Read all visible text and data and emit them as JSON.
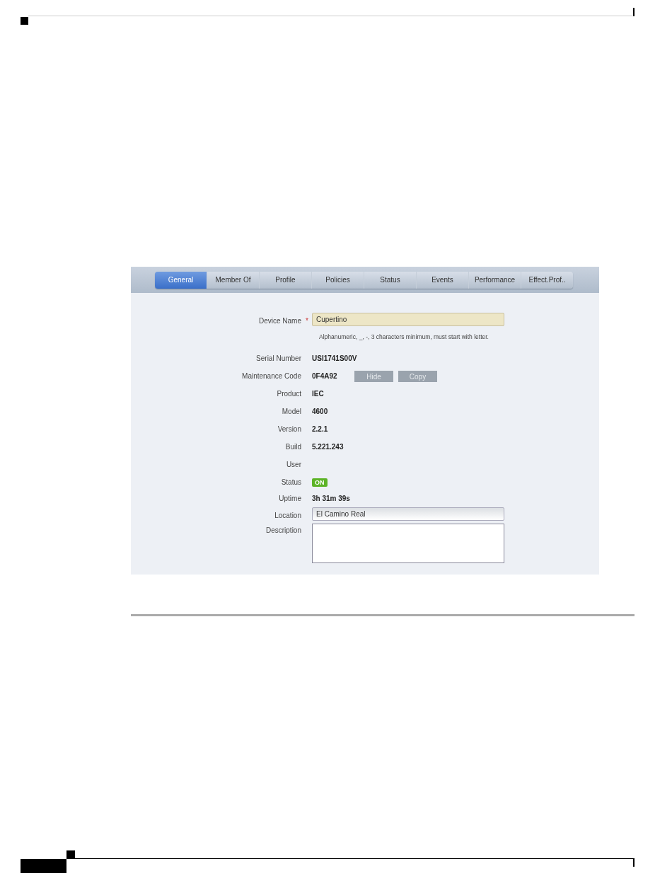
{
  "tabs": [
    {
      "label": "General",
      "selected": true
    },
    {
      "label": "Member Of",
      "selected": false
    },
    {
      "label": "Profile",
      "selected": false
    },
    {
      "label": "Policies",
      "selected": false
    },
    {
      "label": "Status",
      "selected": false
    },
    {
      "label": "Events",
      "selected": false
    },
    {
      "label": "Performance",
      "selected": false
    },
    {
      "label": "Effect.Prof..",
      "selected": false
    }
  ],
  "fields": [
    {
      "kind": "input",
      "label": "Device Name",
      "marker": "*",
      "value": "Cupertino",
      "highlighted": true,
      "hint": "Alphanumeric, _, -, 3 characters minimum, must start with letter."
    },
    {
      "kind": "text",
      "label": "Serial Number",
      "value": "USI1741S00V"
    },
    {
      "kind": "code",
      "label": "Maintenance Code",
      "value": "0F4A92",
      "buttons": [
        "Hide",
        "Copy"
      ]
    },
    {
      "kind": "text",
      "label": "Product",
      "value": "IEC"
    },
    {
      "kind": "text",
      "label": "Model",
      "value": "4600"
    },
    {
      "kind": "text",
      "label": "Version",
      "value": "2.2.1"
    },
    {
      "kind": "text",
      "label": "Build",
      "value": "5.221.243"
    },
    {
      "kind": "text",
      "label": "User"
    },
    {
      "kind": "badge",
      "label": "Status",
      "value": "ON",
      "on": true
    },
    {
      "kind": "text",
      "label": "Uptime",
      "value": "3h 31m 39s"
    },
    {
      "kind": "input",
      "label": "Location",
      "value": "El Camino Real",
      "highlighted": false
    },
    {
      "kind": "textarea",
      "label": "Description"
    }
  ]
}
